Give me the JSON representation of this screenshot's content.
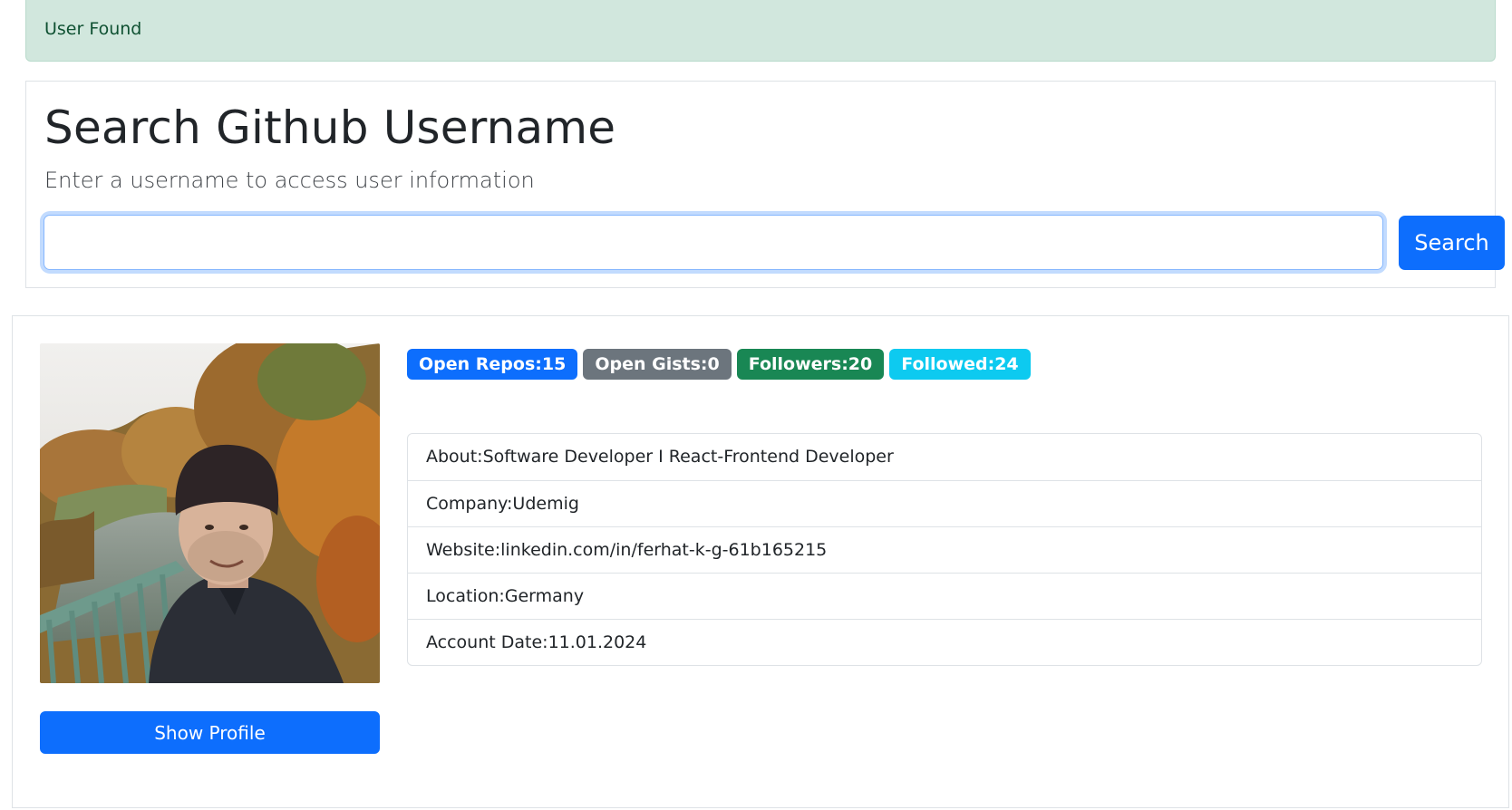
{
  "alert": {
    "text": "User Found",
    "color": "#d1e7dd"
  },
  "search": {
    "title": "Search Github Username",
    "lead": "Enter a username to access user information",
    "input_value": "",
    "button_label": "Search"
  },
  "profile": {
    "avatar": "user-photo",
    "show_profile_label": "Show Profile",
    "badges": [
      {
        "label": "Open Repos:15",
        "color": "#0d6efd"
      },
      {
        "label": "Open Gists:0",
        "color": "#6c757d"
      },
      {
        "label": "Followers:20",
        "color": "#198754"
      },
      {
        "label": "Followed:24",
        "color": "#0dcaf0"
      }
    ],
    "details": [
      "About:Software Developer I React-Frontend Developer",
      "Company:Udemig",
      "Website:linkedin.com/in/ferhat-k-g-61b165215",
      "Location:Germany",
      "Account Date:11.01.2024"
    ]
  }
}
